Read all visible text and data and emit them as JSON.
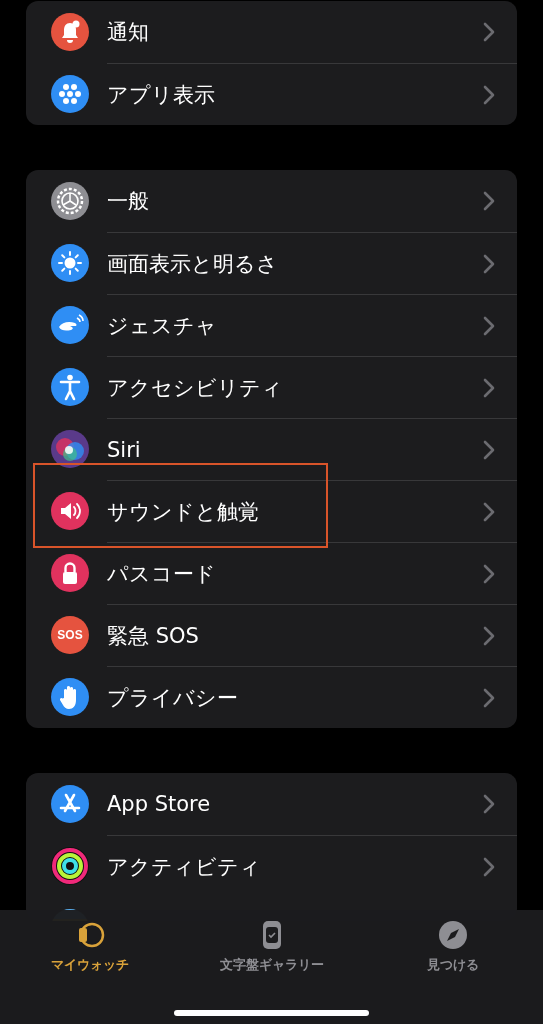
{
  "groups": [
    {
      "items": [
        {
          "label": "通知",
          "color": "#e5533f"
        },
        {
          "label": "アプリ表示",
          "color": "#2f8ef4"
        }
      ]
    },
    {
      "items": [
        {
          "label": "一般",
          "color": "#8e8e93"
        },
        {
          "label": "画面表示と明るさ",
          "color": "#2f8ef4"
        },
        {
          "label": "ジェスチャ",
          "color": "#2f8ef4"
        },
        {
          "label": "アクセシビリティ",
          "color": "#2f8ef4"
        },
        {
          "label": "Siri",
          "color": "#5a3a8a"
        },
        {
          "label": "サウンドと触覚",
          "color": "#e0325e",
          "highlighted": true
        },
        {
          "label": "パスコード",
          "color": "#e0325e"
        },
        {
          "label": "緊急 SOS",
          "color": "#e5533f",
          "icon_text": "SOS"
        },
        {
          "label": "プライバシー",
          "color": "#2f8ef4"
        }
      ]
    },
    {
      "items": [
        {
          "label": "App Store",
          "color": "#2f8ef4"
        },
        {
          "label": "アクティビティ",
          "color": "#111111"
        }
      ]
    }
  ],
  "tabs": [
    {
      "label": "マイウォッチ",
      "selected": true
    },
    {
      "label": "文字盤ギャラリー",
      "selected": false
    },
    {
      "label": "見つける",
      "selected": false
    }
  ]
}
